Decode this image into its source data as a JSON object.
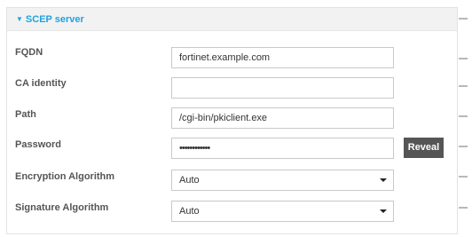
{
  "section": {
    "title": "SCEP server",
    "toggle_glyph": "▼"
  },
  "fields": {
    "fqdn": {
      "label": "FQDN",
      "value": "fortinet.example.com"
    },
    "ca_identity": {
      "label": "CA identity",
      "value": ""
    },
    "path": {
      "label": "Path",
      "value": "/cgi-bin/pkiclient.exe"
    },
    "password": {
      "label": "Password",
      "value": "••••••••••••"
    },
    "encryption": {
      "label": "Encryption Algorithm",
      "value": "Auto"
    },
    "signature": {
      "label": "Signature Algorithm",
      "value": "Auto"
    }
  },
  "buttons": {
    "reveal_label": "Reveal"
  },
  "icons": {
    "row_menu": "more-horizontal-icon",
    "dropdown": "chevron-down-icon"
  },
  "colors": {
    "accent": "#1fa3e0",
    "button_bg": "#555555"
  }
}
